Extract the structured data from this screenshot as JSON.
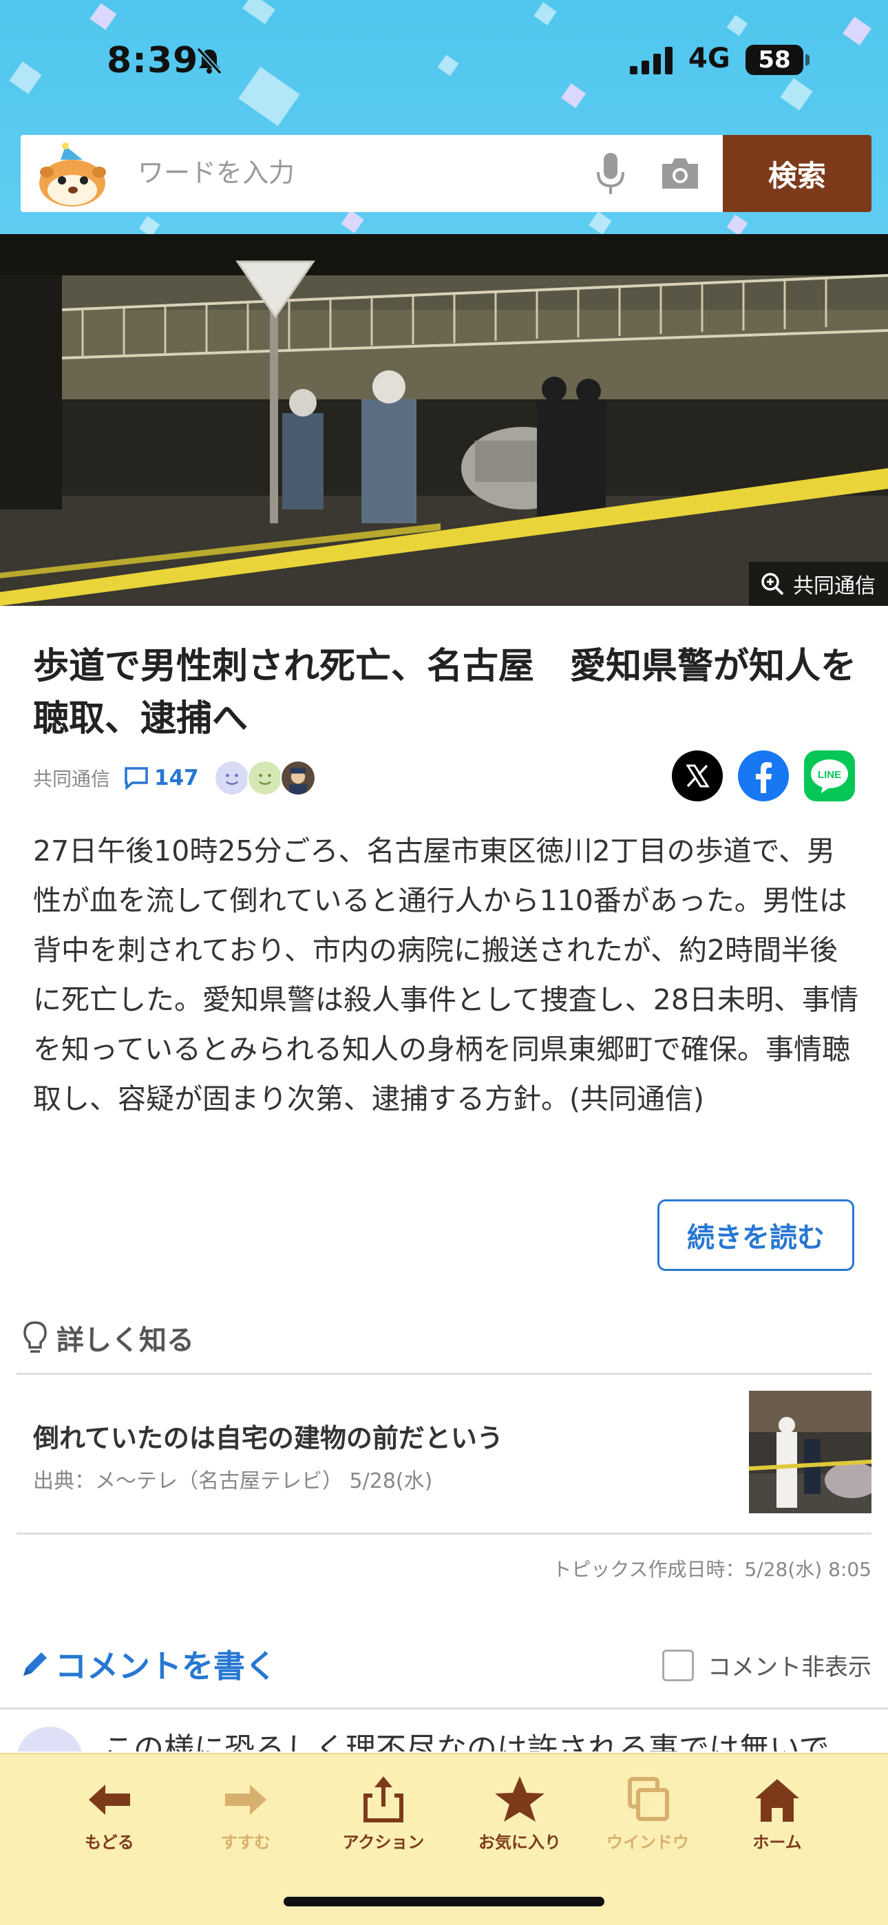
{
  "status": {
    "time": "8:39",
    "network": "4G",
    "battery": "58"
  },
  "search": {
    "placeholder": "ワードを入力",
    "button_label": "検索"
  },
  "hero": {
    "credit": "共同通信"
  },
  "article": {
    "title": "歩道で男性刺され死亡、名古屋　愛知県警が知人を聴取、逮捕へ",
    "source": "共同通信",
    "comment_count": "147",
    "body": "27日午後10時25分ごろ、名古屋市東区徳川2丁目の歩道で、男性が血を流して倒れていると通行人から110番があった。男性は背中を刺されており、市内の病院に搬送されたが、約2時間半後に死亡した。愛知県警は殺人事件として捜査し、28日未明、事情を知っているとみられる知人の身柄を同県東郷町で確保。事情聴取し、容疑が固まり次第、逮捕する方針。(共同通信)",
    "read_more": "続きを読む"
  },
  "learn_more": {
    "heading": "詳しく知る",
    "items": [
      {
        "title": "倒れていたのは自宅の建物の前だという",
        "source": "出典：メ〜テレ（名古屋テレビ）",
        "date": "5/28(水)"
      }
    ],
    "topics_created": "トピックス作成日時：5/28(水) 8:05"
  },
  "comments": {
    "write_label": "コメントを書く",
    "hide_label": "コメント非表示",
    "preview_text": "この様に恐ろしく理不尽なのは許される事では無いで"
  },
  "toolbar": {
    "items": [
      {
        "label": "もどる",
        "icon": "back-arrow-icon"
      },
      {
        "label": "すすむ",
        "icon": "forward-arrow-icon"
      },
      {
        "label": "アクション",
        "icon": "share-icon"
      },
      {
        "label": "お気に入り",
        "icon": "star-icon"
      },
      {
        "label": "ウインドウ",
        "icon": "windows-icon"
      },
      {
        "label": "ホーム",
        "icon": "home-icon"
      }
    ]
  },
  "colors": {
    "header_bg": "#50c6ee",
    "search_button": "#7d3a1b",
    "link_blue": "#2777d2",
    "toolbar_bg": "#fbefb4"
  }
}
